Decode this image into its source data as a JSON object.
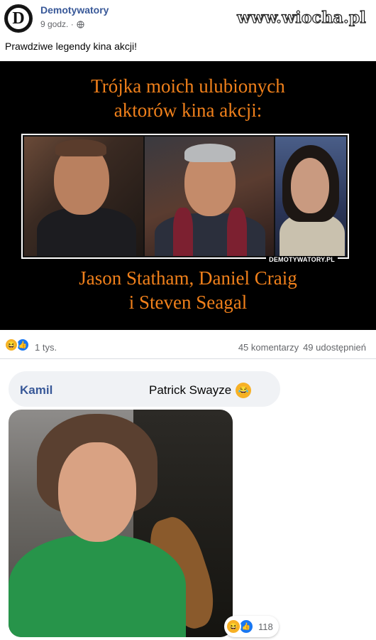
{
  "post": {
    "page_name": "Demotywatory",
    "time": "9 godz. ·",
    "watermark": "www.wiocha.pl",
    "text": "Prawdziwe legendy kina akcji!",
    "avatar_letter": "D"
  },
  "demotivator": {
    "title_line1": "Trójka moich ulubionych",
    "title_line2": "aktorów kina akcji:",
    "bottom_line1": "Jason Statham, Daniel Craig",
    "bottom_line2": "i Steven Seagal",
    "site_label": "DEMOTYWATORY.PL"
  },
  "reactions": {
    "count": "1 tys.",
    "comments": "45 komentarzy",
    "shares": "49 udostępnień"
  },
  "comment": {
    "author": "Kamil",
    "text": "Patrick Swayze",
    "reaction_count": "118"
  },
  "colors": {
    "brand": "#385898",
    "demot_text": "#f0801b",
    "like": "#1877f2",
    "haha": "#f7b125"
  },
  "icons": [
    "globe-icon",
    "haha-icon",
    "like-icon"
  ]
}
